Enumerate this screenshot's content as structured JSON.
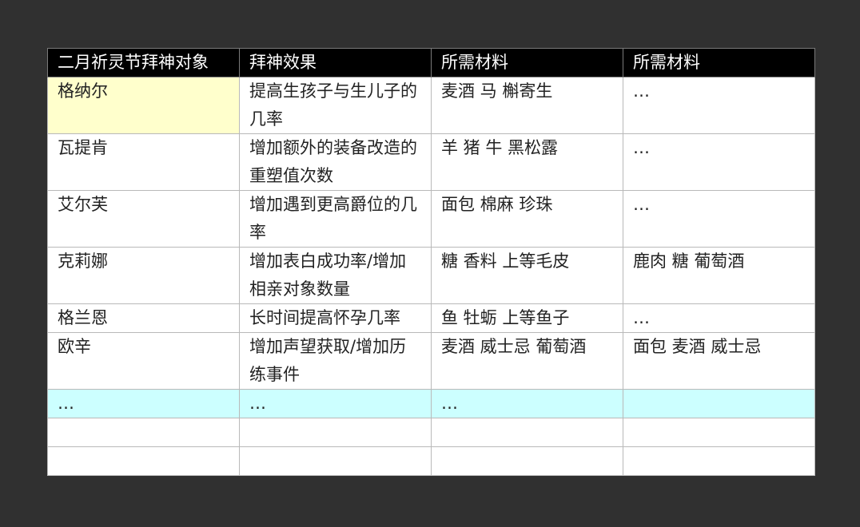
{
  "table": {
    "headers": [
      "二月祈灵节拜神对象",
      "拜神效果",
      "所需材料",
      "所需材料"
    ],
    "rows": [
      [
        "格纳尔",
        "提高生孩子与生儿子的几率",
        "麦酒  马  槲寄生",
        "…"
      ],
      [
        "瓦提肯",
        "增加额外的装备改造的重塑值次数",
        "羊  猪  牛  黑松露",
        "…"
      ],
      [
        "艾尔芙",
        "增加遇到更高爵位的几率",
        "面包  棉麻  珍珠",
        "…"
      ],
      [
        "克莉娜",
        "增加表白成功率/增加相亲对象数量",
        "糖  香料  上等毛皮",
        "鹿肉  糖  葡萄酒"
      ],
      [
        "格兰恩",
        "长时间提高怀孕几率",
        "鱼  牡蛎  上等鱼子",
        "…"
      ],
      [
        "欧辛",
        "增加声望获取/增加历练事件",
        "麦酒  威士忌  葡萄酒",
        "面包  麦酒  威士忌"
      ],
      [
        "…",
        "…",
        "…",
        ""
      ],
      [
        "",
        "",
        "",
        ""
      ],
      [
        "",
        "",
        "",
        ""
      ]
    ]
  },
  "colors": {
    "background": "#303030",
    "header_bg": "#000000",
    "header_text": "#ffffff",
    "highlight_yellow": "#ffffcc",
    "highlight_cyan": "#ccffff",
    "grid": "#b9b9b9"
  }
}
